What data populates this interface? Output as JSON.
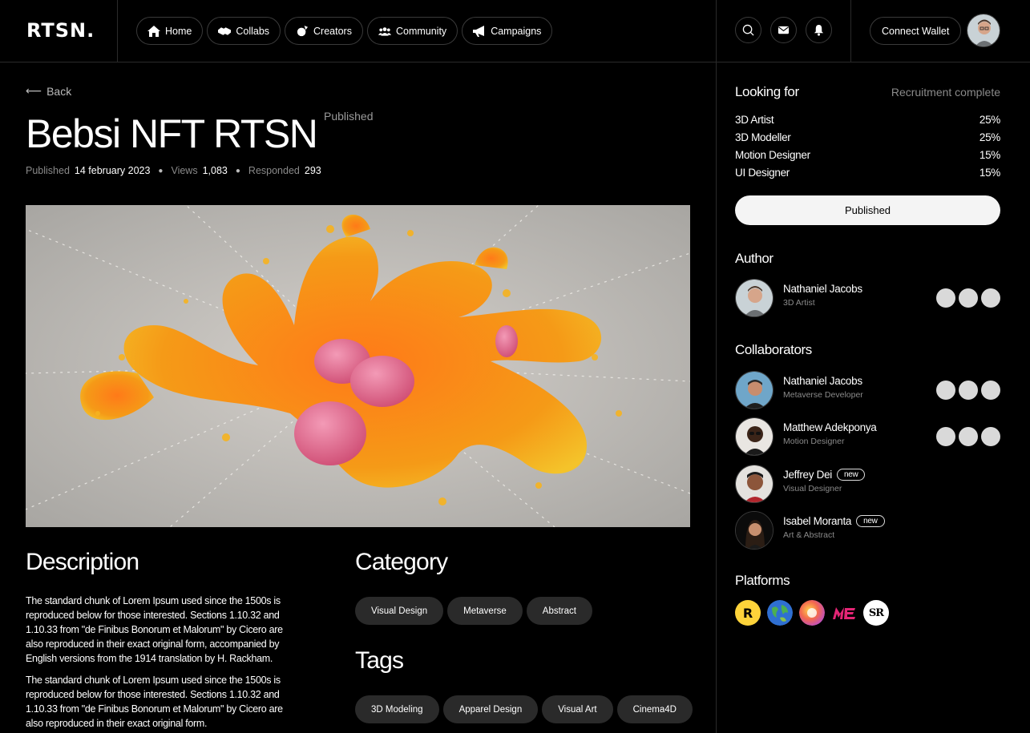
{
  "brand": "RTSN.",
  "nav": [
    {
      "label": "Home",
      "icon": "home-icon"
    },
    {
      "label": "Collabs",
      "icon": "collabs-icon"
    },
    {
      "label": "Creators",
      "icon": "creators-icon"
    },
    {
      "label": "Community",
      "icon": "community-icon"
    },
    {
      "label": "Campaigns",
      "icon": "megaphone-icon"
    }
  ],
  "header": {
    "connect_wallet": "Connect Wallet",
    "icons": [
      "search-icon",
      "mail-icon",
      "bell-icon"
    ]
  },
  "page": {
    "back": "Back",
    "title": "Bebsi NFT RTSN",
    "title_status": "Published",
    "meta": {
      "published_label": "Published",
      "published_value": "14 february 2023",
      "views_label": "Views",
      "views_value": "1,083",
      "responded_label": "Responded",
      "responded_value": "293"
    }
  },
  "description": {
    "heading": "Description",
    "paragraphs": [
      "The standard chunk of Lorem Ipsum used since the 1500s is reproduced below for those interested. Sections 1.10.32 and 1.10.33 from \"de Finibus Bonorum et Malorum\" by Cicero are also reproduced in their exact original form, accompanied by English versions from the 1914 translation by H. Rackham.",
      "The standard chunk of Lorem Ipsum used since the 1500s is reproduced below for those interested. Sections 1.10.32 and 1.10.33 from \"de Finibus Bonorum et Malorum\" by Cicero are also reproduced in their exact original form."
    ]
  },
  "category": {
    "heading": "Category",
    "items": [
      "Visual Design",
      "Metaverse",
      "Abstract"
    ]
  },
  "tags": {
    "heading": "Tags",
    "items": [
      "3D Modeling",
      "Apparel Design",
      "Visual Art",
      "Cinema4D"
    ]
  },
  "looking_for": {
    "heading": "Looking for",
    "status": "Recruitment complete",
    "roles": [
      {
        "name": "3D Artist",
        "pct": "25%"
      },
      {
        "name": "3D Modeller",
        "pct": "25%"
      },
      {
        "name": "Motion Designer",
        "pct": "15%"
      },
      {
        "name": "UI Designer",
        "pct": "15%"
      }
    ],
    "button": "Published"
  },
  "author": {
    "heading": "Author",
    "name": "Nathaniel Jacobs",
    "role": "3D Artist"
  },
  "collaborators": {
    "heading": "Collaborators",
    "people": [
      {
        "name": "Nathaniel Jacobs",
        "role": "Metaverse Developer",
        "badge": ""
      },
      {
        "name": "Matthew Adekponya",
        "role": "Motion Designer",
        "badge": ""
      },
      {
        "name": "Jeffrey Dei",
        "role": "Visual Designer",
        "badge": "new"
      },
      {
        "name": "Isabel Moranta",
        "role": "Art & Abstract",
        "badge": "new"
      }
    ]
  },
  "platforms": {
    "heading": "Platforms",
    "items": [
      {
        "label": "R",
        "icon": "rarible-icon",
        "color": "#fdd33a"
      },
      {
        "label": "",
        "icon": "globe-icon",
        "color": "#2f6fd1"
      },
      {
        "label": "",
        "icon": "foundation-icon",
        "color": "#f2674f"
      },
      {
        "label": "ME",
        "icon": "magic-eden-icon",
        "color": "#e42575"
      },
      {
        "label": "SR",
        "icon": "superrare-icon",
        "color": "#ffffff"
      }
    ]
  }
}
